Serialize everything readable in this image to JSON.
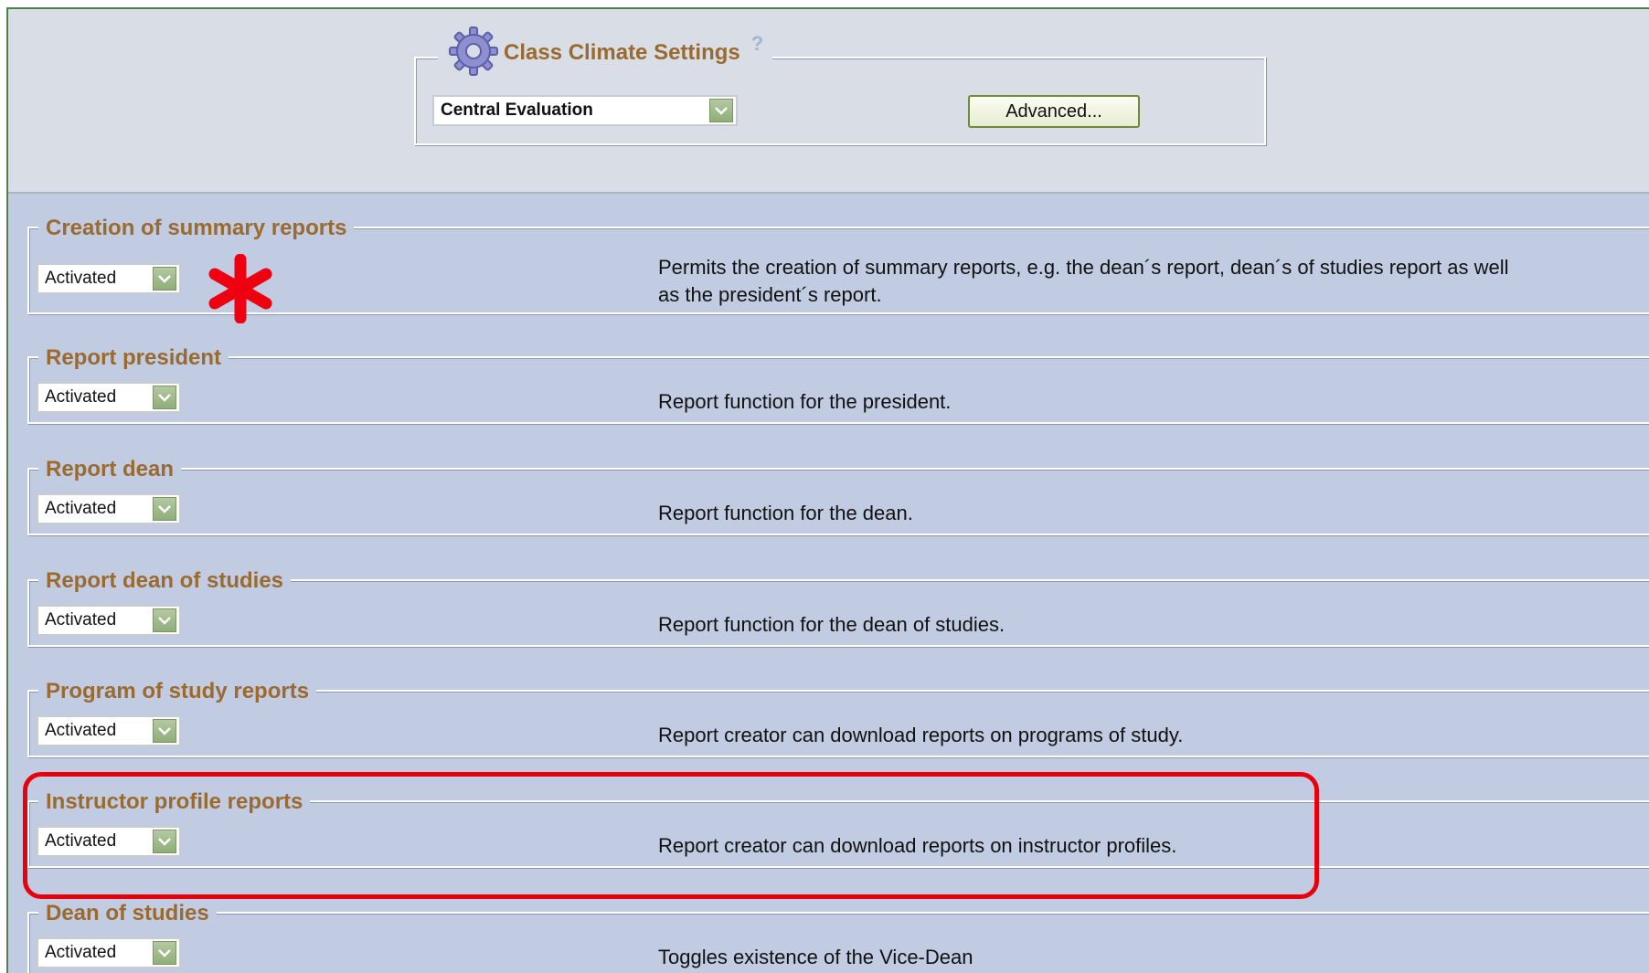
{
  "settings": {
    "title": "Class Climate Settings",
    "help_label": "?",
    "mode_value": "Central Evaluation",
    "advanced_label": "Advanced..."
  },
  "rows": [
    {
      "title": "Creation of summary reports",
      "value": "Activated",
      "description_line1": "Permits the creation of summary reports, e.g. the dean´s report, dean´s of studies report as well",
      "description_line2": "as the president´s report."
    },
    {
      "title": "Report president",
      "value": "Activated",
      "description": "Report function for the president."
    },
    {
      "title": "Report dean",
      "value": "Activated",
      "description": "Report function for the dean."
    },
    {
      "title": "Report dean of studies",
      "value": "Activated",
      "description": "Report function for the dean of studies."
    },
    {
      "title": "Program of study reports",
      "value": "Activated",
      "description": "Report creator can download reports on programs of study."
    },
    {
      "title": "Instructor profile reports",
      "value": "Activated",
      "description": "Report creator can download reports on instructor profiles."
    },
    {
      "title": "Dean of studies",
      "value": "Activated",
      "description": "Toggles existence of the Vice-Dean"
    }
  ],
  "colors": {
    "legend_text": "#9a6a2e",
    "panel_bg": "#c1cce3",
    "header_bg": "#d8dde6",
    "highlight": "#e8000d",
    "dropdown_arrow": "#8fae79"
  },
  "icons": [
    "gear-icon",
    "help-icon",
    "chevron-down-icon",
    "asterisk-annotation"
  ]
}
